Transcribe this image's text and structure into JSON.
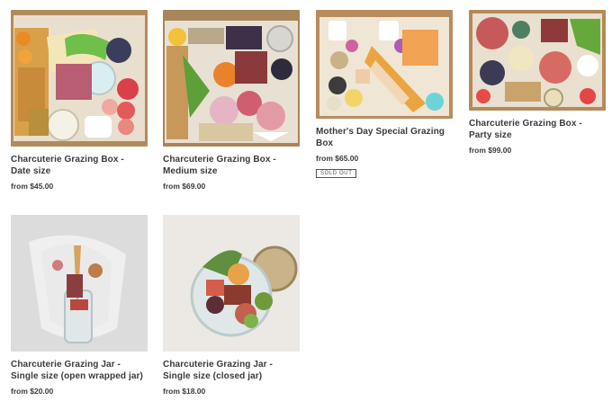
{
  "products": [
    {
      "title_line1": "Charcuterie Grazing Box -",
      "title_line2": "Date size",
      "price": "from $45.00",
      "image": "grazing-box-date"
    },
    {
      "title_line1": "Charcuterie Grazing Box -",
      "title_line2": "Medium size",
      "price": "from $69.00",
      "image": "grazing-box-medium"
    },
    {
      "title_line1": "Mother's Day Special Grazing",
      "title_line2": "Box",
      "price": "from $65.00",
      "badge": "SOLD OUT",
      "image": "mothers-day-box"
    },
    {
      "title_line1": "Charcuterie Grazing Box -",
      "title_line2": "Party size",
      "price": "from $99.00",
      "image": "grazing-box-party"
    },
    {
      "title_line1": "Charcuterie Grazing Jar -",
      "title_line2": "Single size (open wrapped jar)",
      "price": "from $20.00",
      "image": "grazing-jar-open"
    },
    {
      "title_line1": "Charcuterie Grazing Jar -",
      "title_line2": "Single size (closed jar)",
      "price": "from $18.00",
      "image": "grazing-jar-closed"
    }
  ]
}
